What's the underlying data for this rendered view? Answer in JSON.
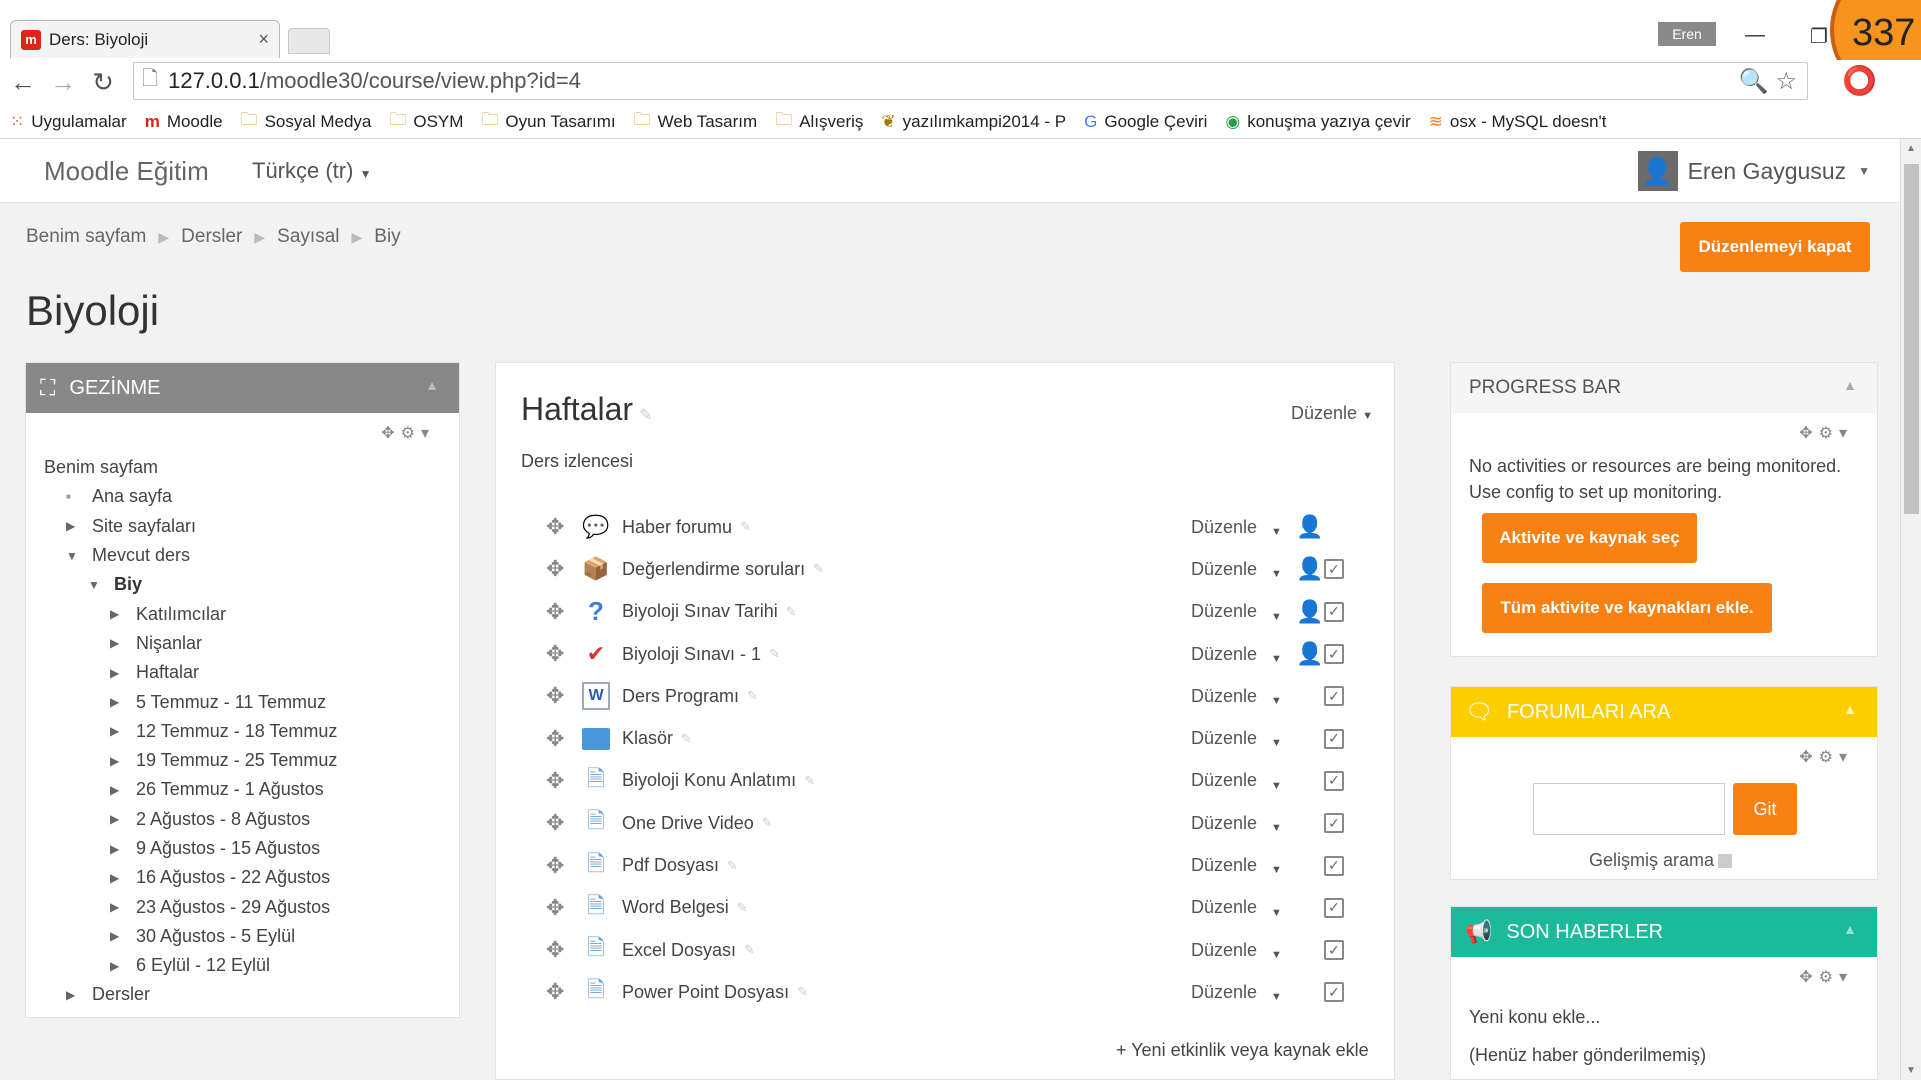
{
  "browser": {
    "tab_title": "Ders: Biyoloji",
    "tab_close": "×",
    "profile": "Eren",
    "counter": "337",
    "url_host": "127.0.0.1",
    "url_path": "/moodle30/course/view.php?id=4",
    "bookmarks": [
      {
        "label": "Uygulamalar",
        "icon": "apps-icon"
      },
      {
        "label": "Moodle",
        "icon": "moodle-icon"
      },
      {
        "label": "Sosyal Medya",
        "icon": "folder-icon"
      },
      {
        "label": "OSYM",
        "icon": "folder-icon"
      },
      {
        "label": "Oyun Tasarımı",
        "icon": "folder-icon"
      },
      {
        "label": "Web Tasarım",
        "icon": "folder-icon"
      },
      {
        "label": "Alışveriş",
        "icon": "folder-icon"
      },
      {
        "label": "yazılımkampi2014 - P",
        "icon": "site-icon"
      },
      {
        "label": "Google Çeviri",
        "icon": "translate-icon"
      },
      {
        "label": "konuşma yazıya çevir",
        "icon": "chrome-icon"
      },
      {
        "label": "osx - MySQL doesn't",
        "icon": "stack-icon"
      }
    ]
  },
  "navbar": {
    "brand": "Moodle Eğitim",
    "language": "Türkçe (tr)",
    "user": "Eren Gaygusuz"
  },
  "breadcrumb": [
    "Benim sayfam",
    "Dersler",
    "Sayısal",
    "Biy"
  ],
  "edit_button": "Düzenlemeyi kapat",
  "page_title": "Biyoloji",
  "nav_block": {
    "title": "GEZİNME",
    "items": [
      {
        "label": "Benim sayfam",
        "indent": 0,
        "marker": ""
      },
      {
        "label": "Ana sayfa",
        "indent": 1,
        "marker": "■"
      },
      {
        "label": "Site sayfaları",
        "indent": 1,
        "marker": "▶"
      },
      {
        "label": "Mevcut ders",
        "indent": 1,
        "marker": "▼"
      },
      {
        "label": "Biy",
        "indent": 2,
        "marker": "▼",
        "bold": true
      },
      {
        "label": "Katılımcılar",
        "indent": 3,
        "marker": "▶"
      },
      {
        "label": "Nişanlar",
        "indent": 3,
        "marker": "▶"
      },
      {
        "label": "Haftalar",
        "indent": 3,
        "marker": "▶"
      },
      {
        "label": "5 Temmuz - 11 Temmuz",
        "indent": 3,
        "marker": "▶"
      },
      {
        "label": "12 Temmuz - 18 Temmuz",
        "indent": 3,
        "marker": "▶"
      },
      {
        "label": "19 Temmuz - 25 Temmuz",
        "indent": 3,
        "marker": "▶"
      },
      {
        "label": "26 Temmuz - 1 Ağustos",
        "indent": 3,
        "marker": "▶"
      },
      {
        "label": "2 Ağustos - 8 Ağustos",
        "indent": 3,
        "marker": "▶"
      },
      {
        "label": "9 Ağustos - 15 Ağustos",
        "indent": 3,
        "marker": "▶"
      },
      {
        "label": "16 Ağustos - 22 Ağustos",
        "indent": 3,
        "marker": "▶"
      },
      {
        "label": "23 Ağustos - 29 Ağustos",
        "indent": 3,
        "marker": "▶"
      },
      {
        "label": "30 Ağustos - 5 Eylül",
        "indent": 3,
        "marker": "▶"
      },
      {
        "label": "6 Eylül - 12 Eylül",
        "indent": 3,
        "marker": "▶"
      },
      {
        "label": "Dersler",
        "indent": 1,
        "marker": "▶"
      }
    ]
  },
  "section": {
    "title": "Haftalar",
    "edit_label": "Düzenle",
    "syllabus": "Ders izlencesi",
    "add_activity": "+ Yeni etkinlik veya kaynak ekle",
    "activities": [
      {
        "name": "Haber forumu",
        "icon": "forum-icon",
        "user": true,
        "check": false
      },
      {
        "name": "Değerlendirme soruları",
        "icon": "feedback-icon",
        "user": true,
        "check": true
      },
      {
        "name": "Biyoloji Sınav Tarihi",
        "icon": "question-icon",
        "user": true,
        "check": true
      },
      {
        "name": "Biyoloji Sınavı - 1",
        "icon": "quiz-icon",
        "user": true,
        "check": true
      },
      {
        "name": "Ders Programı",
        "icon": "word-doc-icon",
        "user": false,
        "check": true
      },
      {
        "name": "Klasör",
        "icon": "folder-icon",
        "user": false,
        "check": true
      },
      {
        "name": "Biyoloji Konu Anlatımı",
        "icon": "page-icon",
        "user": false,
        "check": true
      },
      {
        "name": "One Drive Video",
        "icon": "page-icon",
        "user": false,
        "check": true
      },
      {
        "name": "Pdf Dosyası",
        "icon": "page-icon",
        "user": false,
        "check": true
      },
      {
        "name": "Word Belgesi",
        "icon": "page-icon",
        "user": false,
        "check": true
      },
      {
        "name": "Excel Dosyası",
        "icon": "page-icon",
        "user": false,
        "check": true
      },
      {
        "name": "Power Point Dosyası",
        "icon": "page-icon",
        "user": false,
        "check": true
      }
    ]
  },
  "progress_block": {
    "title": "PROGRESS BAR",
    "message_1": "No activities or resources are being monitored.",
    "message_2": "Use config to set up monitoring.",
    "button_select": "Aktivite ve kaynak seç",
    "button_add_all": "Tüm aktivite ve kaynakları ekle."
  },
  "forum_block": {
    "title": "FORUMLARI ARA",
    "search_value": "",
    "go_label": "Git",
    "advanced": "Gelişmiş arama"
  },
  "news_block": {
    "title": "SON HABERLER",
    "add_topic": "Yeni konu ekle...",
    "empty": "(Henüz haber gönderilmemiş)"
  },
  "colors": {
    "accent_orange": "#f98012",
    "nav_header": "#888888",
    "forum_header": "#ffce00",
    "news_header": "#1bba9a"
  }
}
